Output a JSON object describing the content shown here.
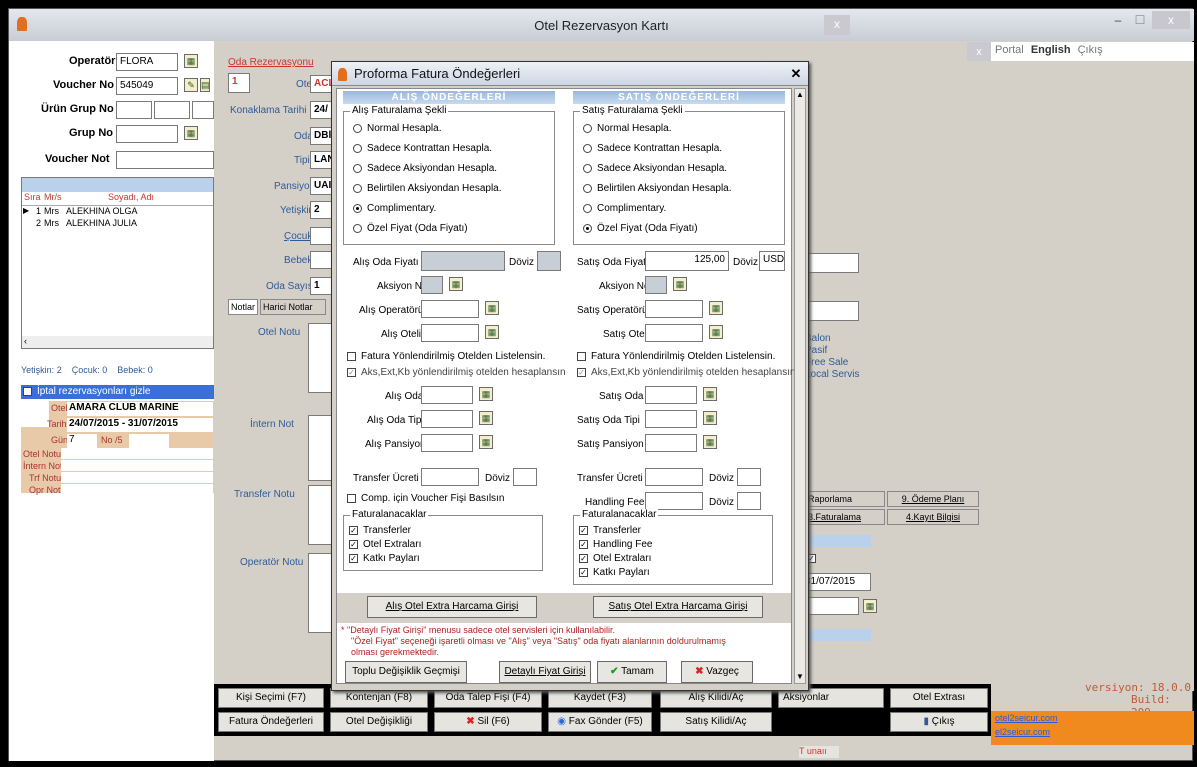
{
  "window": {
    "title": "Otel Rezervasyon Kartı",
    "close": "x",
    "min": "–",
    "max": "☐"
  },
  "topnav": {
    "portal": "Portal",
    "english": "English",
    "exit": "Çıkış"
  },
  "left": {
    "operator_label": "Operatör",
    "operator_value": "FLORA",
    "voucher_label": "Voucher No",
    "voucher_value": "545049",
    "urun_grup_label": "Ürün Grup No",
    "grup_label": "Grup No",
    "voucher_not_label": "Voucher Not",
    "grid_headers": [
      "Sıra",
      "Mr/s",
      "Soyadı, Adı"
    ],
    "rows": [
      {
        "no": "1",
        "title": "Mrs",
        "name": "ALEKHINA OLGA"
      },
      {
        "no": "2",
        "title": "Mrs",
        "name": "ALEKHINA JULIA"
      }
    ],
    "summary_yetiskin": "Yetişkin: 2",
    "summary_cocuk": "Çocuk: 0",
    "summary_bebek": "Bebek: 0",
    "iptal": "İptal rezervasyonları gizle",
    "otel_label": "Otel",
    "otel_value": "AMARA CLUB MARINE",
    "tarih_label": "Tarih",
    "tarih_value": "24/07/2015 - 31/07/2015",
    "gun_label": "Gün",
    "gun_value": "7",
    "no_label": "No /5",
    "notes": [
      "Otel Notu",
      "İntern Not",
      "Trf Notu",
      "Opr Notu"
    ]
  },
  "mid": {
    "section": "Oda Rezervasyonu",
    "no": "1",
    "otel_label": "Otel",
    "otel_value": "ACL",
    "konaklama_label": "Konaklama Tarihi",
    "konaklama_value": "24/",
    "oda_label": "Oda",
    "oda_value": "DBl",
    "tipi_label": "Tipi",
    "tipi_value": "LAN",
    "pansiyon_label": "Pansiyon",
    "pansiyon_value": "UAI",
    "yetiskin_label": "Yetişkin",
    "yetiskin_value": "2",
    "cocuk_label": "Çocuk",
    "bebek_label": "Bebek",
    "oda_sayisi_label": "Oda Sayısı",
    "oda_sayisi_value": "1",
    "tabs": [
      "Notlar",
      "Harici Notlar"
    ],
    "notes": [
      "Otel Notu",
      "İntern Not",
      "Transfer Notu",
      "Operatör Notu"
    ]
  },
  "right": {
    "options": [
      "Balon",
      "Pasif",
      "Free Sale",
      "Local Servis"
    ],
    "tabs": [
      "Raporlama",
      "9. Ödeme Planı",
      "3.Faturalama",
      "4.Kayıt Bilgisi"
    ],
    "date_value": "31/07/2015",
    "version": "versiyon: 18.0.0",
    "build": "Build: 209",
    "link1": "otel2seicur.com",
    "link2": "el2seicur.com",
    "hidden_btn": "T unaıı"
  },
  "dialog": {
    "title": "Proforma Fatura Öndeğerleri",
    "alis_header": "ALIŞ ÖNDEĞERLERİ",
    "satis_header": "SATIŞ ÖNDEĞERLERİ",
    "alis_group": "Alış Faturalama Şekli",
    "satis_group": "Satış Faturalama Şekli",
    "alis_radios": [
      "Normal Hesapla.",
      "Sadece Kontrattan Hesapla.",
      "Sadece Aksiyondan Hesapla.",
      "Belirtilen Aksiyondan Hesapla.",
      "Complimentary.",
      "Özel Fiyat (Oda Fiyatı)"
    ],
    "alis_selected": 4,
    "satis_radios": [
      "Normal Hesapla.",
      "Sadece Kontrattan Hesapla.",
      "Sadece Aksiyondan Hesapla.",
      "Belirtilen Aksiyondan Hesapla.",
      "Complimentary.",
      "Özel Fiyat (Oda Fiyatı)"
    ],
    "satis_selected": 5,
    "alis_oda_fiyati": "Alış Oda Fiyatı",
    "doviz": "Döviz",
    "satis_oda_fiyati": "Satış Oda Fiyatı",
    "satis_oda_fiyati_value": "125,00",
    "satis_doviz_value": "USD",
    "aksiyon_no": "Aksiyon No",
    "alis_operatoru": "Alış Operatörü",
    "alis_oteli": "Alış Oteli",
    "satis_operatoru": "Satış Operatörü",
    "satis_oteli": "Satış Oteli",
    "fatura_yon": "Fatura Yönlendirilmiş Otelden Listelensin.",
    "aks_ext": "Aks,Ext,Kb  yönlendirilmiş otelden hesaplansın",
    "alis_oda": "Alış Oda",
    "alis_oda_tipi": "Alış Oda Tipi",
    "alis_pansiyon": "Alış Pansiyon",
    "satis_oda": "Satış Oda",
    "satis_oda_tipi": "Satış Oda Tipi",
    "satis_pansiyon": "Satış Pansiyon",
    "transfer_ucreti": "Transfer Ücreti",
    "handling_fee": "Handling Fee",
    "comp_voucher": "Comp. için Voucher Fişi Basılsın",
    "faturalanacaklar": "Faturalanacaklar",
    "alis_fat": [
      "Transferler",
      "Otel Extraları",
      "Katkı Payları"
    ],
    "satis_fat": [
      "Transferler",
      "Handling Fee",
      "Otel Extraları",
      "Katkı Payları"
    ],
    "alis_extra_btn": "Alış Otel Extra Harcama Girişi",
    "satis_extra_btn": "Satış Otel Extra Harcama Girişi",
    "note1": "* \"Detaylı Fiyat Girişi\" menusu sadece otel servisleri için kullanılabilir.",
    "note2": "\"Özel Fiyat\" seçeneği işaretli olması ve \"Alış\" veya \"Satış\" oda fiyatı alanlarının doldurulmamış",
    "note3": "olması gerekmektedir.",
    "toplu_btn": "Toplu Değişiklik Geçmişi",
    "detayli_btn": "Detaylı Fiyat Girişi",
    "tamam_btn": "Tamam",
    "vazgec_btn": "Vazgeç"
  },
  "toolbar": {
    "row1": [
      "Kişi Seçimi  (F7)",
      "Kontenjan (F8)",
      "Oda Talep Fişi (F4)",
      "Kaydet  (F3)",
      "Alış Kilidi/Aç",
      "Aksiyonlar",
      "Otel Extrası"
    ],
    "row2": [
      "Fatura Öndeğerleri",
      "Otel Değişikliği",
      "Sil  (F6)",
      "Fax Gönder (F5)",
      "Satış Kilidi/Aç",
      "",
      "Çıkış"
    ]
  }
}
